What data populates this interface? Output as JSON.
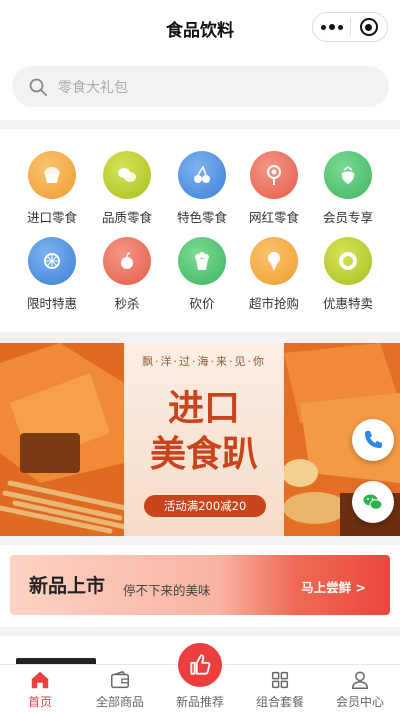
{
  "header": {
    "title": "食品饮料"
  },
  "search": {
    "placeholder": "零食大礼包"
  },
  "categories": [
    {
      "label": "进口零食",
      "icon": "cupcake-icon",
      "color": "#f3a945"
    },
    {
      "label": "品质零食",
      "icon": "cookies-icon",
      "color": "#b7cc2b"
    },
    {
      "label": "特色零食",
      "icon": "cherry-icon",
      "color": "#4b8fe0"
    },
    {
      "label": "网红零食",
      "icon": "lollipop-icon",
      "color": "#ec6e5a"
    },
    {
      "label": "会员专享",
      "icon": "strawberry-icon",
      "color": "#4cc36d"
    },
    {
      "label": "限时特惠",
      "icon": "lemon-slice-icon",
      "color": "#4b8fe0"
    },
    {
      "label": "秒杀",
      "icon": "apple-icon",
      "color": "#ec6e5a"
    },
    {
      "label": "砍价",
      "icon": "popcorn-icon",
      "color": "#4cc36d"
    },
    {
      "label": "超市抢购",
      "icon": "ice-cream-icon",
      "color": "#f3a945"
    },
    {
      "label": "优惠特卖",
      "icon": "donut-icon",
      "color": "#b7cc2b"
    }
  ],
  "banner": {
    "subtitle": "飘·洋·过·海·来·见·你",
    "headline_line1": "进口",
    "headline_line2": "美食趴",
    "promo": "活动满200减20"
  },
  "new_arrivals": {
    "title": "新品上市",
    "subtitle": "停不下来的美味",
    "cta": "马上尝鲜 >"
  },
  "tabbar": [
    {
      "label": "首页",
      "icon": "home-icon",
      "active": true
    },
    {
      "label": "全部商品",
      "icon": "wallet-icon",
      "active": false
    },
    {
      "label": "新品推荐",
      "icon": "thumbs-up-icon",
      "active": false
    },
    {
      "label": "组合套餐",
      "icon": "grid-icon",
      "active": false
    },
    {
      "label": "会员中心",
      "icon": "user-icon",
      "active": false
    }
  ],
  "colors": {
    "accent": "#e94141",
    "promo": "#c9431c"
  }
}
